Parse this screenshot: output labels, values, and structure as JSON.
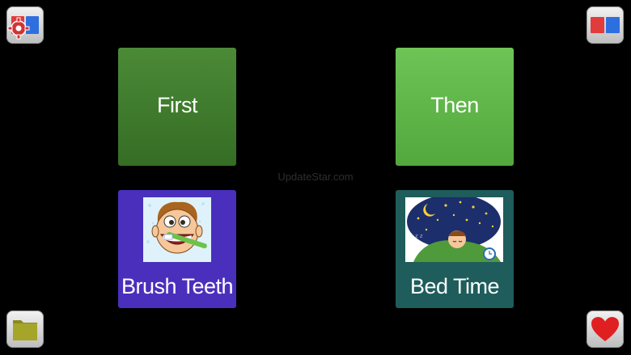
{
  "watermark": "UpdateStar.com",
  "tiles": {
    "first": {
      "label": "First",
      "color": "#3f7b2e"
    },
    "then": {
      "label": "Then",
      "color": "#5fb647"
    },
    "brush": {
      "label": "Brush Teeth",
      "color": "#4a2fbd",
      "picture": "boy-brushing-teeth-picture"
    },
    "bed": {
      "label": "Bed Time",
      "color": "#1f5c5c",
      "picture": "boy-sleeping-picture"
    }
  },
  "corners": {
    "top_left": {
      "icon": "settings-gear-icon"
    },
    "top_right": {
      "icon": "red-blue-split-icon"
    },
    "bottom_left": {
      "icon": "folder-icon"
    },
    "bottom_right": {
      "icon": "heart-icon"
    }
  }
}
